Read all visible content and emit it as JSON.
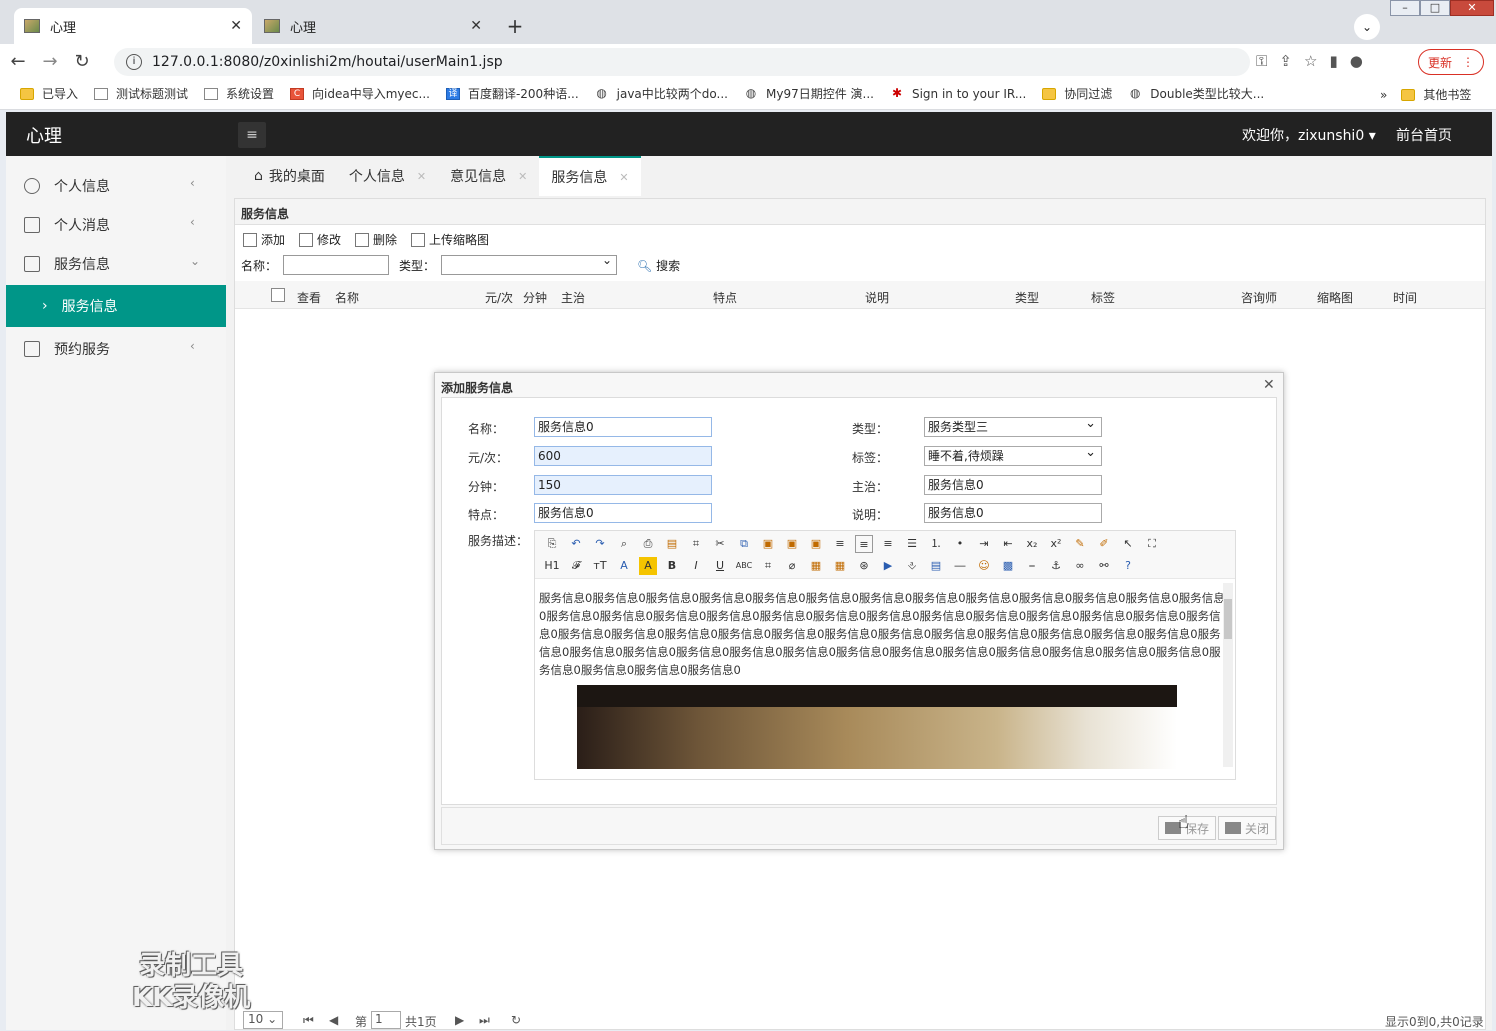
{
  "browser": {
    "tabs": [
      {
        "title": "心理",
        "active": true
      },
      {
        "title": "心理",
        "active": false
      }
    ],
    "new_tab": "+",
    "url": "127.0.0.1:8080/z0xinlishi2m/houtai/userMain1.jsp",
    "update_label": "更新",
    "bookmarks": [
      {
        "label": "已导入",
        "icon": "folder-icon"
      },
      {
        "label": "测试标题测试",
        "icon": "page-icon"
      },
      {
        "label": "系统设置",
        "icon": "page-icon"
      },
      {
        "label": "向idea中导入myec...",
        "icon": "csdn-icon"
      },
      {
        "label": "百度翻译-200种语...",
        "icon": "translate-icon"
      },
      {
        "label": "java中比较两个do...",
        "icon": "globe-icon"
      },
      {
        "label": "My97日期控件 演...",
        "icon": "globe-icon"
      },
      {
        "label": "Sign in to your IR...",
        "icon": "maple-leaf-icon"
      },
      {
        "label": "协同过滤",
        "icon": "folder-icon"
      },
      {
        "label": "Double类型比较大...",
        "icon": "globe-icon"
      }
    ],
    "bookmarks_more": "»",
    "other_bookmarks": "其他书签"
  },
  "header": {
    "logo": "心理",
    "welcome": "欢迎你，zixunshi0",
    "front_home": "前台首页"
  },
  "sidebar": {
    "items": [
      {
        "label": "个人信息"
      },
      {
        "label": "个人消息"
      },
      {
        "label": "服务信息"
      },
      {
        "label": "服务信息",
        "sub": true
      },
      {
        "label": "预约服务"
      }
    ]
  },
  "page_tabs": [
    {
      "label": "我的桌面"
    },
    {
      "label": "个人信息"
    },
    {
      "label": "意见信息"
    },
    {
      "label": "服务信息",
      "active": true
    }
  ],
  "panel": {
    "title": "服务信息",
    "toolbar": [
      "添加",
      "修改",
      "删除",
      "上传缩略图"
    ],
    "search": {
      "name_label": "名称：",
      "type_label": "类型：",
      "button": "搜索"
    },
    "columns": [
      "查看",
      "名称",
      "元/次",
      "分钟",
      "主治",
      "特点",
      "说明",
      "类型",
      "标签",
      "咨询师",
      "缩略图",
      "时间"
    ],
    "pager": {
      "page_size": "10",
      "page_prefix": "第",
      "page": "1",
      "total_pages": "共1页",
      "summary": "显示0到0,共0记录"
    }
  },
  "dialog": {
    "title": "添加服务信息",
    "fields": {
      "name_label": "名称：",
      "name_value": "服务信息0",
      "price_label": "元/次：",
      "price_value": "600",
      "minutes_label": "分钟：",
      "minutes_value": "150",
      "feature_label": "特点：",
      "feature_value": "服务信息0",
      "type_label": "类型：",
      "type_value": "服务类型三",
      "tag_label": "标签：",
      "tag_value": "睡不着,待烦躁",
      "treat_label": "主治：",
      "treat_value": "服务信息0",
      "desc_label": "说明：",
      "desc_value": "服务信息0",
      "detail_label": "服务描述："
    },
    "editor_text": "服务信息0服务信息0服务信息0服务信息0服务信息0服务信息0服务信息0服务信息0服务信息0服务信息0服务信息0服务信息0服务信息0服务信息0服务信息0服务信息0服务信息0服务信息0服务信息0服务信息0服务信息0服务信息0服务信息0服务信息0服务信息0服务信息0服务信息0服务信息0服务信息0服务信息0服务信息0服务信息0服务信息0服务信息0服务信息0服务信息0服务信息0服务信息0服务信息0服务信息0服务信息0服务信息0服务信息0服务信息0服务信息0服务信息0服务信息0服务信息0服务信息0服务信息0服务信息0服务信息0服务信息0服务信息0服务信息0",
    "save_label": "保存",
    "close_label": "关闭"
  },
  "watermark": {
    "line1": "录制工具",
    "line2": "KK录像机"
  },
  "colors": {
    "accent": "#009688",
    "header_bg": "#222222",
    "update": "#d93025"
  }
}
